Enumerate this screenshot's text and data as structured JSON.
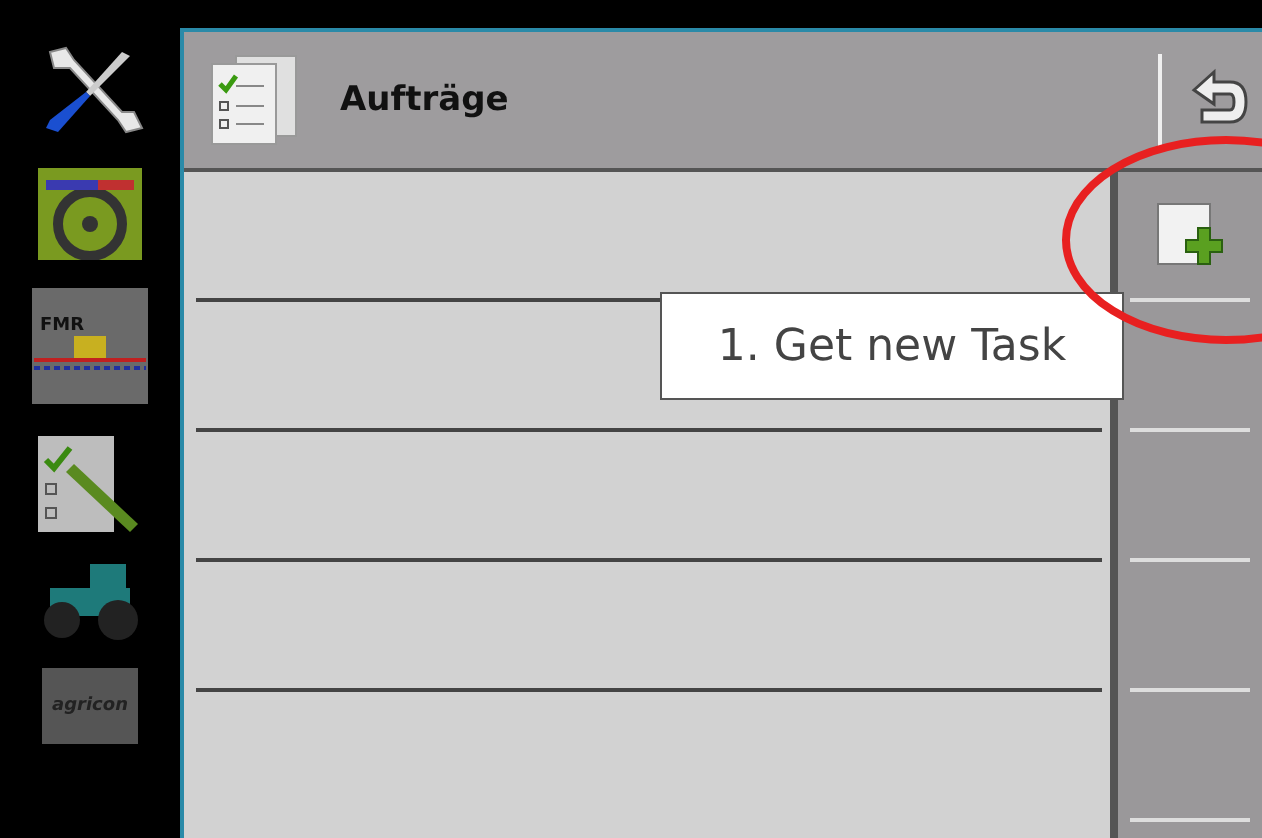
{
  "sidebar": {
    "items": [
      {
        "kind": "tools"
      },
      {
        "kind": "steering"
      },
      {
        "kind": "implement",
        "label": "FMR"
      },
      {
        "kind": "tasks"
      },
      {
        "kind": "tractor"
      },
      {
        "kind": "logo",
        "label": "agricon"
      }
    ]
  },
  "window": {
    "title": "Aufträge"
  },
  "callout": {
    "text": "1. Get new Task"
  }
}
